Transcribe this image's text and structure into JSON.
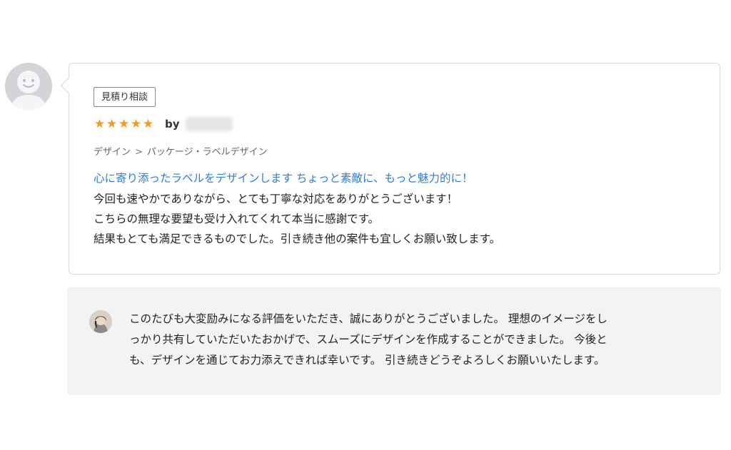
{
  "review": {
    "tag": "見積り相談",
    "rating": 5,
    "stars": [
      "★",
      "★",
      "★",
      "★",
      "★"
    ],
    "by_label": "by",
    "category": {
      "parent": "デザイン",
      "separator": ">",
      "child": "パッケージ・ラベルデザイン"
    },
    "service_title": "心に寄り添ったラベルをデザインします ちょっと素敵に、もっと魅力的に！",
    "body_lines": [
      "今回も速やかでありながら、とても丁寧な対応をありがとうございます！",
      "こちらの無理な要望も受け入れてくれて本当に感謝です。",
      "結果もとても満足できるものでした。引き続き他の案件も宜しくお願い致します。"
    ]
  },
  "reply": {
    "lines": [
      "このたびも大変励みになる評価をいただき、誠にありがとうございました。 理想のイメージをし",
      "っかり共有していただいたおかげで、スムーズにデザインを作成することができました。 今後と",
      "も、デザインを通じてお力添えできれば幸いです。 引き続きどうぞよろしくお願いいたします。"
    ]
  },
  "icons": {
    "reviewer_avatar": "default-user-avatar-icon",
    "star": "star-icon",
    "seller_avatar": "seller-photo-avatar"
  },
  "colors": {
    "star": "#f59a1b",
    "service_title": "#2e7fd6",
    "reply_background": "#f2f3f5",
    "card_border": "#d7d9dc"
  }
}
